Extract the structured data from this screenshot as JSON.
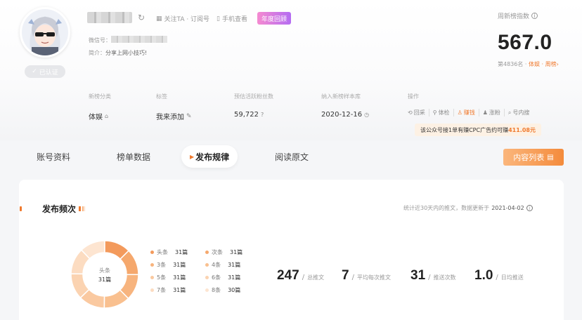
{
  "profile": {
    "verified_label": "已认证",
    "follow_link": "关注TA · 订阅号",
    "mobile_link": "手机查看",
    "year_badge": "年度回顾",
    "wechat_id_label": "微信号：",
    "intro_label": "简介：",
    "intro_value": "分享上网小技巧!"
  },
  "rank": {
    "label": "周新榜指数",
    "value": "567.0",
    "sub_prefix": "第4836名 · ",
    "sub_highlight": "体娱 · 周榜",
    "sub_arrow": "›"
  },
  "info": {
    "category_label": "新榜分类",
    "category_value": "体娱",
    "tag_label": "标签",
    "tag_value": "我来添加",
    "fans_label": "预估活跃粉丝数",
    "fans_value": "59,722",
    "sample_label": "纳入新榜样本库",
    "sample_value": "2020-12-16",
    "ops_label": "操作"
  },
  "ops": [
    {
      "label": "回采",
      "icon": "refresh-icon"
    },
    {
      "label": "体检",
      "icon": "checkup-icon"
    },
    {
      "label": "赚钱",
      "icon": "money-icon"
    },
    {
      "label": "涨粉",
      "icon": "user-plus-icon"
    },
    {
      "label": "号内搜",
      "icon": "search-icon"
    }
  ],
  "cpc_tip": {
    "prefix": "该公众号接1单有赚CPC广告约可赚",
    "amount": "411.08元"
  },
  "tabs": [
    "账号资料",
    "榜单数据",
    "发布规律",
    "阅读原文"
  ],
  "active_tab": "发布规律",
  "content_list_button": "内容列表",
  "section": {
    "title": "发布频次",
    "note": "统计近30天内的推文，数据更新于",
    "date": "2021-04-02"
  },
  "donut_center": {
    "label": "头条",
    "value": "31篇"
  },
  "chart_data": {
    "type": "pie",
    "categories": [
      "头条",
      "次条",
      "3条",
      "4条",
      "5条",
      "6条",
      "7条",
      "8条"
    ],
    "values": [
      31,
      31,
      31,
      31,
      31,
      31,
      31,
      30
    ],
    "unit": "篇",
    "colors": [
      "#f39a5c",
      "#f5a86d",
      "#f7b47e",
      "#f9c08f",
      "#fac9a0",
      "#fbd3b1",
      "#fcdcc1",
      "#fde5d1"
    ]
  },
  "kpis": [
    {
      "value": "247",
      "desc": "总推文"
    },
    {
      "value": "7",
      "desc": "平均每次推文"
    },
    {
      "value": "31",
      "desc": "推送次数"
    },
    {
      "value": "1.0",
      "desc": "日均推送"
    }
  ],
  "kpi_separator": "/"
}
